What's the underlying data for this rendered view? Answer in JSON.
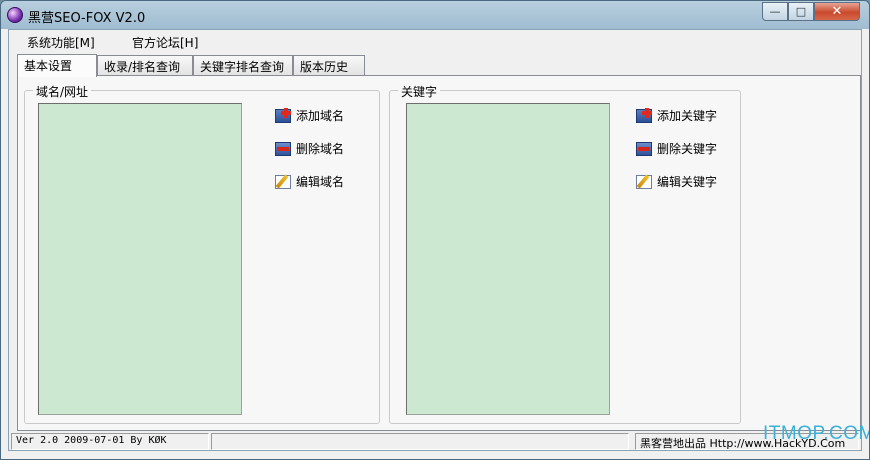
{
  "window": {
    "title": "黑营SEO-FOX V2.0",
    "close_glyph": "✕",
    "min_glyph": "—",
    "max_glyph": "□"
  },
  "menu": [
    {
      "label": "系统功能[M]"
    },
    {
      "label": "官方论坛[H]"
    }
  ],
  "tabs": [
    {
      "label": "基本设置",
      "active": true
    },
    {
      "label": "收录/排名查询"
    },
    {
      "label": "关键字排名查询"
    },
    {
      "label": "版本历史"
    }
  ],
  "domain_group": {
    "legend": "域名/网址",
    "buttons": {
      "add": "添加域名",
      "delete": "删除域名",
      "edit": "编辑域名"
    }
  },
  "keyword_group": {
    "legend": "关键字",
    "buttons": {
      "add": "添加关键字",
      "delete": "删除关键字",
      "edit": "编辑关键字"
    }
  },
  "status": {
    "version_text": "Ver 2.0   2009-07-01   By KØK",
    "middle_text": "",
    "credit_text": "黑客营地出品 Http://www.HackYD.Com"
  },
  "watermark": "ITMOP.COM",
  "colors": {
    "listbox_bg": "#cde8d0",
    "close_button": "#c94a2d"
  }
}
